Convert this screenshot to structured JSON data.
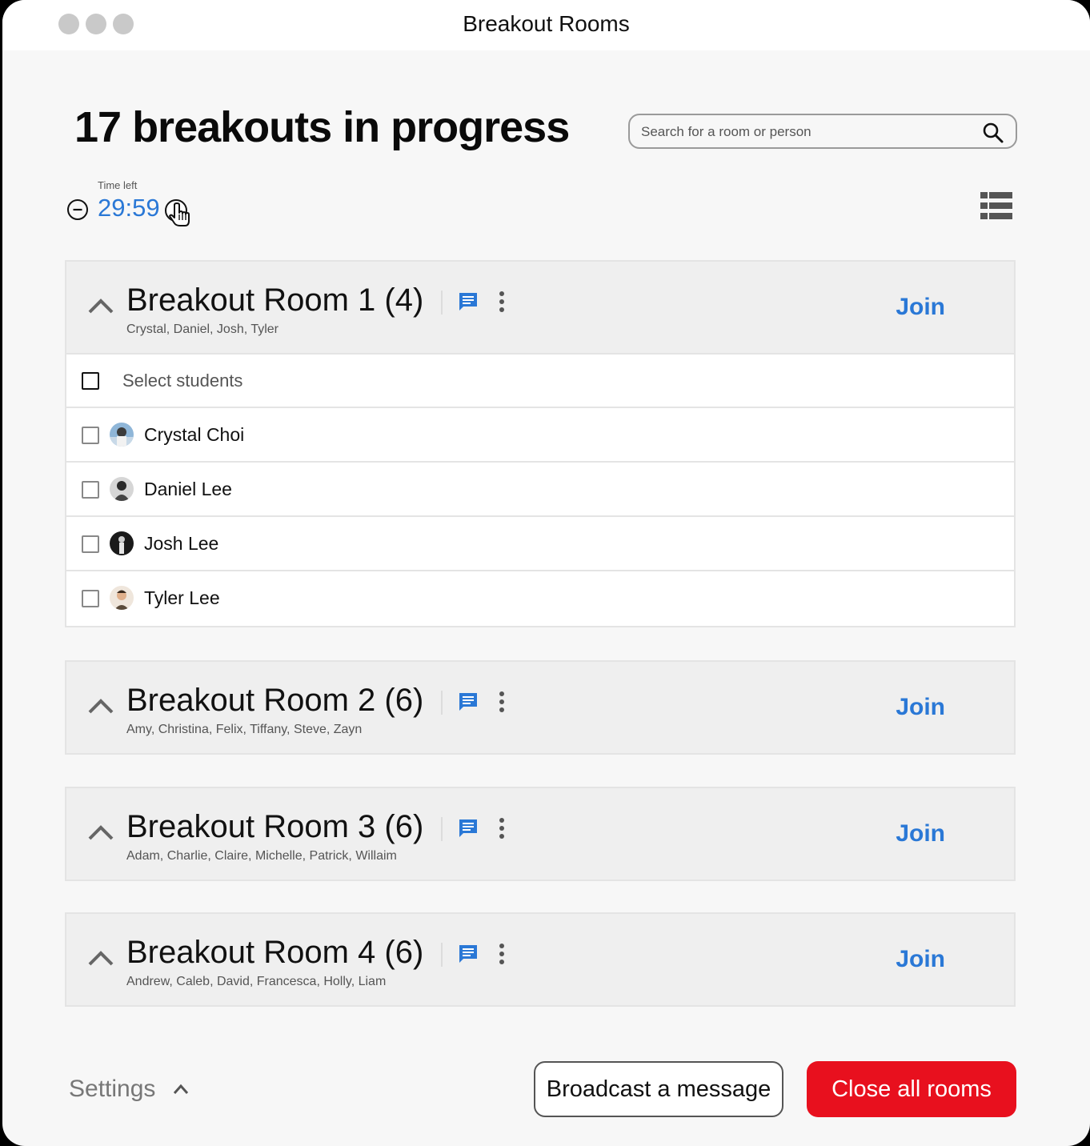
{
  "window": {
    "title": "Breakout Rooms"
  },
  "header": {
    "title": "17 breakouts in progress",
    "search_placeholder": "Search for a room or person"
  },
  "timer": {
    "label": "Time left",
    "value": "29:59"
  },
  "rooms": [
    {
      "name": "Breakout Room 1 (4)",
      "members": "Crystal, Daniel, Josh, Tyler",
      "join_label": "Join",
      "expanded": true,
      "select_label": "Select students",
      "students": [
        {
          "name": "Crystal Choi"
        },
        {
          "name": "Daniel Lee"
        },
        {
          "name": "Josh Lee"
        },
        {
          "name": "Tyler Lee"
        }
      ]
    },
    {
      "name": "Breakout Room 2 (6)",
      "members": "Amy, Christina, Felix, Tiffany, Steve, Zayn",
      "join_label": "Join"
    },
    {
      "name": "Breakout Room 3 (6)",
      "members": "Adam, Charlie, Claire, Michelle, Patrick, Willaim",
      "join_label": "Join"
    },
    {
      "name": "Breakout Room 4 (6)",
      "members": "Andrew, Caleb, David, Francesca, Holly, Liam",
      "join_label": "Join"
    }
  ],
  "footer": {
    "settings_label": "Settings",
    "broadcast_label": "Broadcast a message",
    "close_label": "Close all rooms"
  },
  "colors": {
    "accent": "#2a78d6",
    "danger": "#e8101e",
    "background": "#f7f7f7",
    "card": "#efefef"
  }
}
